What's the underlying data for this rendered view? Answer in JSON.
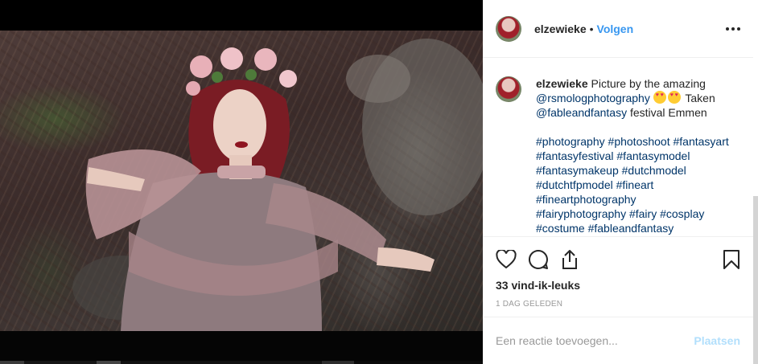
{
  "post": {
    "image": {
      "icon": "photo-of-woman-with-flower-crown"
    },
    "header": {
      "username": "elzewieke",
      "separator": "•",
      "follow_label": "Volgen",
      "more_icon": "more-horizontal-icon"
    },
    "caption": {
      "username": "elzewieke",
      "text_1": "Picture by the amazing",
      "mention_1": "@rsmologphotography",
      "emoji": "heart-eyes-emoji",
      "text_2": "Taken",
      "mention_2": "@fableandfantasy",
      "text_3": "festival Emmen",
      "hashtags": [
        "#photography",
        "#photoshoot",
        "#fantasyart",
        "#fantasyfestival",
        "#fantasymodel",
        "#fantasymakeup",
        "#dutchmodel",
        "#dutchtfpmodel",
        "#fineart",
        "#fineartphotography",
        "#fairyphotography",
        "#fairy",
        "#cosplay",
        "#costume",
        "#fableandfantasy"
      ]
    },
    "actions": {
      "like_icon": "heart-icon",
      "comment_icon": "comment-icon",
      "share_icon": "share-icon",
      "save_icon": "bookmark-icon"
    },
    "likes": "33 vind-ik-leuks",
    "timestamp": "1 DAG GELEDEN",
    "comment": {
      "placeholder": "Een reactie toevoegen...",
      "value": "",
      "post_label": "Plaatsen"
    }
  },
  "colors": {
    "link_blue": "#3897f0",
    "mention_blue": "#003569",
    "post_disabled": "#b2dffc",
    "text": "#262626",
    "muted": "#999999"
  }
}
